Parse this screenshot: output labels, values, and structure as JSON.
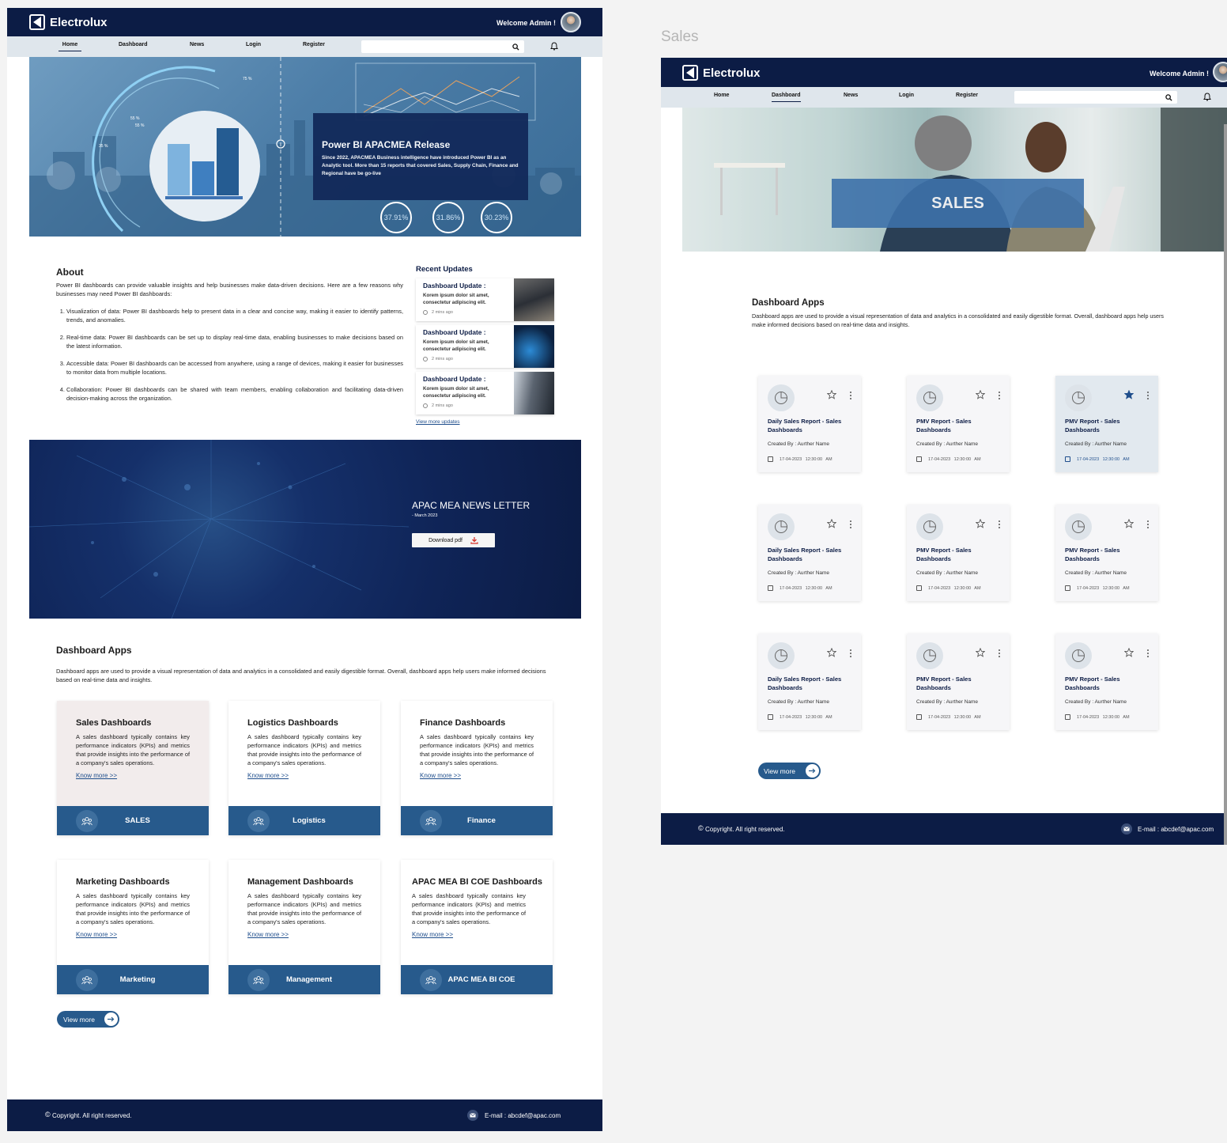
{
  "brand": "Electrolux",
  "welcome": "Welcome Admin !",
  "page_label": "Sales",
  "nav": {
    "home": "Home",
    "dashboard": "Dashboard",
    "news": "News",
    "login": "Login",
    "register": "Register"
  },
  "hero": {
    "title": "Power BI APACMEA Release",
    "body": "Since 2022, APACMEA Business intelligence have introduced Power BI as an Analytic tool. More than 15 reports that covered Sales, Supply Chain, Finance and Regional have be go-live",
    "stats": [
      "37.91%",
      "31.86%",
      "30.23%"
    ],
    "ring_labels": [
      "75 %",
      "55 %",
      "55 %",
      "35 %"
    ]
  },
  "about": {
    "title": "About",
    "intro": "Power BI dashboards can provide valuable insights and help businesses make data-driven decisions. Here are a few reasons why businesses may need Power BI dashboards:",
    "items": [
      "Visualization of data: Power BI dashboards help to present data in a clear and concise way, making it easier to identify patterns, trends, and anomalies.",
      "Real-time data: Power BI dashboards can be set up to display real-time data, enabling businesses to make decisions based on the latest information.",
      "Accessible data: Power BI dashboards can be accessed from anywhere, using a range of devices, making it easier for businesses to monitor data from multiple locations.",
      "Collaboration: Power BI dashboards can be shared with team members, enabling collaboration and facilitating data-driven decision-making across the organization."
    ]
  },
  "updates": {
    "title": "Recent Updates",
    "items": [
      {
        "title": "Dashboard Update :",
        "body": "Korem ipsum dolor sit amet, consectetur adipiscing elit.",
        "time": "2 mins ago"
      },
      {
        "title": "Dashboard Update :",
        "body": "Korem ipsum dolor sit amet, consectetur adipiscing elit.",
        "time": "2 mins ago"
      },
      {
        "title": "Dashboard Update :",
        "body": "Korem ipsum dolor sit amet, consectetur adipiscing elit.",
        "time": "2 mins ago"
      }
    ],
    "view_more": "View more updates"
  },
  "newsletter": {
    "title": "APAC MEA NEWS LETTER",
    "date": "- March 2023",
    "download": "Download pdf"
  },
  "apps": {
    "title": "Dashboard Apps",
    "desc": "Dashboard apps are used to provide a visual representation of data and analytics in a consolidated and easily digestible format. Overall, dashboard apps help users make informed decisions based on real-time data and insights.",
    "know_more": "Know more >>",
    "card_desc": "A sales dashboard typically contains key performance indicators (KPIs) and metrics that provide insights into the performance of a company's sales operations.",
    "cards": [
      {
        "title": "Sales Dashboards",
        "label": "SALES"
      },
      {
        "title": "Logistics Dashboards",
        "label": "Logistics"
      },
      {
        "title": "Finance Dashboards",
        "label": "Finance"
      },
      {
        "title": "Marketing Dashboards",
        "label": "Marketing"
      },
      {
        "title": "Management Dashboards",
        "label": "Management"
      },
      {
        "title": "APAC MEA BI COE Dashboards",
        "label": "APAC MEA BI COE"
      }
    ],
    "view_more": "View more"
  },
  "footer": {
    "copyright": "Copyright. All right reserved.",
    "email": "E-mail : abcdef@apac.com"
  },
  "sales": {
    "banner": "SALES",
    "apps_title": "Dashboard Apps",
    "apps_desc": "Dashboard apps are used to provide a visual representation of data and analytics in a consolidated and easily digestible format. Overall, dashboard apps help users make informed decisions based on real-time data and insights.",
    "reports": [
      {
        "title": "Daily Sales Report - Sales Dashboards",
        "by": "Created By : Aurther Name",
        "date": "17-04-2023  12:30:00 AM"
      },
      {
        "title": "PMV Report - Sales Dashboards",
        "by": "Created By : Aurther Name",
        "date": "17-04-2023  12:30:00 AM"
      },
      {
        "title": "PMV Report - Sales Dashboards",
        "by": "Created By : Aurther Name",
        "date": "17-04-2023  12:30:00 AM",
        "favorite": true
      },
      {
        "title": "Daily Sales Report - Sales Dashboards",
        "by": "Created By : Aurther Name",
        "date": "17-04-2023  12:30:00 AM"
      },
      {
        "title": "PMV Report - Sales Dashboards",
        "by": "Created By : Aurther Name",
        "date": "17-04-2023  12:30:00 AM"
      },
      {
        "title": "PMV Report - Sales Dashboards",
        "by": "Created By : Aurther Name",
        "date": "17-04-2023  12:30:00 AM"
      },
      {
        "title": "Daily Sales Report - Sales Dashboards",
        "by": "Created By : Aurther Name",
        "date": "17-04-2023  12:30:00 AM"
      },
      {
        "title": "PMV Report - Sales Dashboards",
        "by": "Created By : Aurther Name",
        "date": "17-04-2023  12:30:00 AM"
      },
      {
        "title": "PMV Report - Sales Dashboards",
        "by": "Created By : Aurther Name",
        "date": "17-04-2023  12:30:00 AM"
      }
    ],
    "view_more": "View more"
  },
  "colors": {
    "navy": "#0c1c45",
    "accent": "#275a8c",
    "nav_bg": "#dfe6ec"
  }
}
